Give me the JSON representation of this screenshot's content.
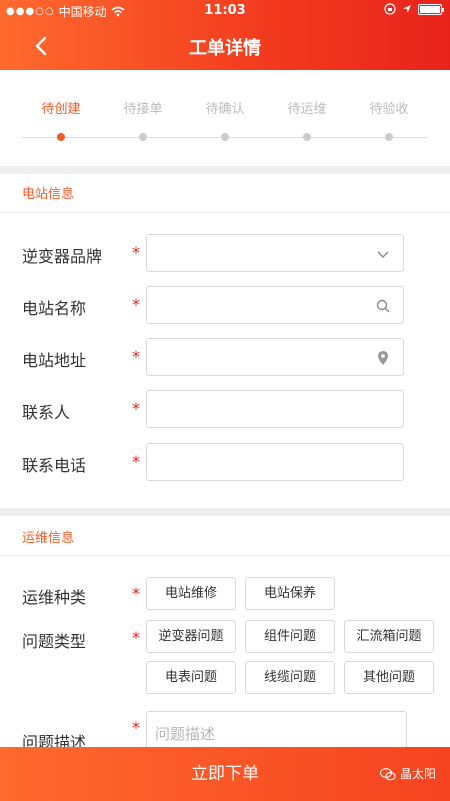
{
  "status": {
    "carrier": "中国移动",
    "time": "11:03",
    "signal_dots": "●●●○○",
    "battery_level": 1.0
  },
  "header": {
    "title": "工单详情"
  },
  "steps": [
    {
      "label": "待创建",
      "active": true
    },
    {
      "label": "待接单",
      "active": false
    },
    {
      "label": "待确认",
      "active": false
    },
    {
      "label": "待运维",
      "active": false
    },
    {
      "label": "待验收",
      "active": false
    }
  ],
  "station": {
    "title": "电站信息",
    "required_mark": "*",
    "fields": [
      {
        "label": "逆变器品牌",
        "icon": "chevron-down-icon"
      },
      {
        "label": "电站名称",
        "icon": "search-icon"
      },
      {
        "label": "电站地址",
        "icon": "location-pin-icon"
      },
      {
        "label": "联系人",
        "icon": ""
      },
      {
        "label": "联系电话",
        "icon": ""
      }
    ]
  },
  "maintenance": {
    "title": "运维信息",
    "type_label": "运维种类",
    "type_options": [
      "电站维修",
      "电站保养"
    ],
    "problem_label": "问题类型",
    "problem_options": [
      "逆变器问题",
      "组件问题",
      "汇流箱问题",
      "电表问题",
      "线缆问题",
      "其他问题"
    ],
    "desc_label": "问题描述",
    "desc_placeholder": "问题描述"
  },
  "submit_label": "立即下单",
  "watermark": "晶太阳",
  "colors": {
    "accent": "#f25b26",
    "required": "#e8231c"
  }
}
